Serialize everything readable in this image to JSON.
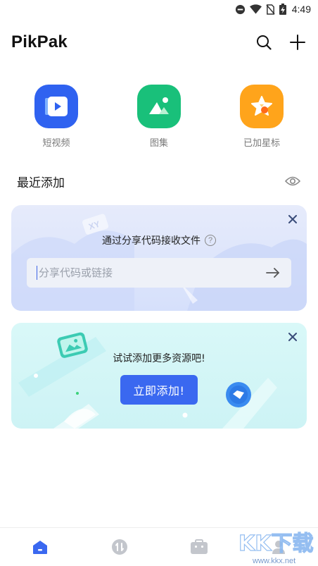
{
  "status_bar": {
    "time": "4:49",
    "icons": [
      "do-not-disturb-icon",
      "wifi-icon",
      "no-sim-icon",
      "battery-charging-icon"
    ]
  },
  "header": {
    "title": "PikPak",
    "actions": [
      {
        "icon": "search-icon"
      },
      {
        "icon": "plus-icon"
      }
    ]
  },
  "quick_access": [
    {
      "label": "短视频",
      "icon": "video-icon",
      "color": "#2f62f0"
    },
    {
      "label": "图集",
      "icon": "image-icon",
      "color": "#19c07a"
    },
    {
      "label": "已加星标",
      "icon": "star-icon",
      "color": "#ffa41b"
    }
  ],
  "recent": {
    "title": "最近添加"
  },
  "share_card": {
    "title": "通过分享代码接收文件",
    "help": "?",
    "input_placeholder": "分享代码或链接",
    "input_value": ""
  },
  "promo_card": {
    "text": "试试添加更多资源吧!",
    "button_label": "立即添加!"
  },
  "bottom_nav": [
    {
      "icon": "home-icon",
      "active": true
    },
    {
      "icon": "transfer-icon",
      "active": false
    },
    {
      "icon": "toolbox-icon",
      "active": false
    },
    {
      "icon": "account-icon",
      "active": false
    }
  ],
  "watermark": {
    "text": "KK下载",
    "url": "www.kkx.net"
  },
  "colors": {
    "accent": "#3a68f0",
    "share_card_bg": "#dde5fb",
    "promo_card_bg": "#d3f6f6"
  }
}
